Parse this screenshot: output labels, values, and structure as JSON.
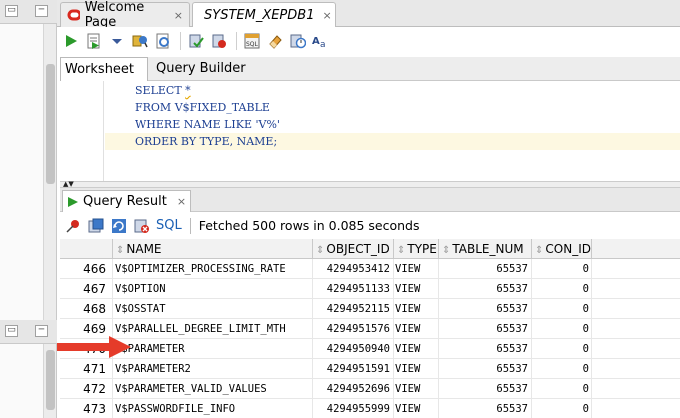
{
  "tabs": [
    {
      "title": "Welcome Page",
      "icon": "oracle-logo-icon",
      "active": false
    },
    {
      "title": "SYSTEM_XEPDB1",
      "icon": "sql-worksheet-icon",
      "active": true
    }
  ],
  "subtabs": {
    "worksheet": "Worksheet",
    "query_builder": "Query Builder"
  },
  "sql_lines": [
    {
      "kw": "SELECT ",
      "rest": "*"
    },
    {
      "kw": "FROM ",
      "rest": "V$FIXED_TABLE"
    },
    {
      "kw": "WHERE ",
      "rest": "NAME LIKE 'V%'"
    },
    {
      "kw": "ORDER BY ",
      "rest": "TYPE, NAME;"
    }
  ],
  "result": {
    "tab_label": "Query Result",
    "sql_link": "SQL",
    "status": "Fetched 500 rows in 0.085 seconds"
  },
  "columns": [
    "NAME",
    "OBJECT_ID",
    "TYPE",
    "TABLE_NUM",
    "CON_ID"
  ],
  "rows": [
    {
      "n": "466",
      "name": "V$OPTIMIZER_PROCESSING_RATE",
      "object_id": "4294953412",
      "type": "VIEW",
      "table_num": "65537",
      "con_id": "0"
    },
    {
      "n": "467",
      "name": "V$OPTION",
      "object_id": "4294951133",
      "type": "VIEW",
      "table_num": "65537",
      "con_id": "0"
    },
    {
      "n": "468",
      "name": "V$OSSTAT",
      "object_id": "4294952115",
      "type": "VIEW",
      "table_num": "65537",
      "con_id": "0"
    },
    {
      "n": "469",
      "name": "V$PARALLEL_DEGREE_LIMIT_MTH",
      "object_id": "4294951576",
      "type": "VIEW",
      "table_num": "65537",
      "con_id": "0"
    },
    {
      "n": "470",
      "name": "V$PARAMETER",
      "object_id": "4294950940",
      "type": "VIEW",
      "table_num": "65537",
      "con_id": "0"
    },
    {
      "n": "471",
      "name": "V$PARAMETER2",
      "object_id": "4294951591",
      "type": "VIEW",
      "table_num": "65537",
      "con_id": "0"
    },
    {
      "n": "472",
      "name": "V$PARAMETER_VALID_VALUES",
      "object_id": "4294952696",
      "type": "VIEW",
      "table_num": "65537",
      "con_id": "0"
    },
    {
      "n": "473",
      "name": "V$PASSWORDFILE_INFO",
      "object_id": "4294955999",
      "type": "VIEW",
      "table_num": "65537",
      "con_id": "0"
    }
  ],
  "colors": {
    "keyword": "#1d3f92",
    "highlight_line": "#fdf8e1",
    "annotation_arrow": "#e53b2a",
    "link": "#1a5fb4"
  }
}
